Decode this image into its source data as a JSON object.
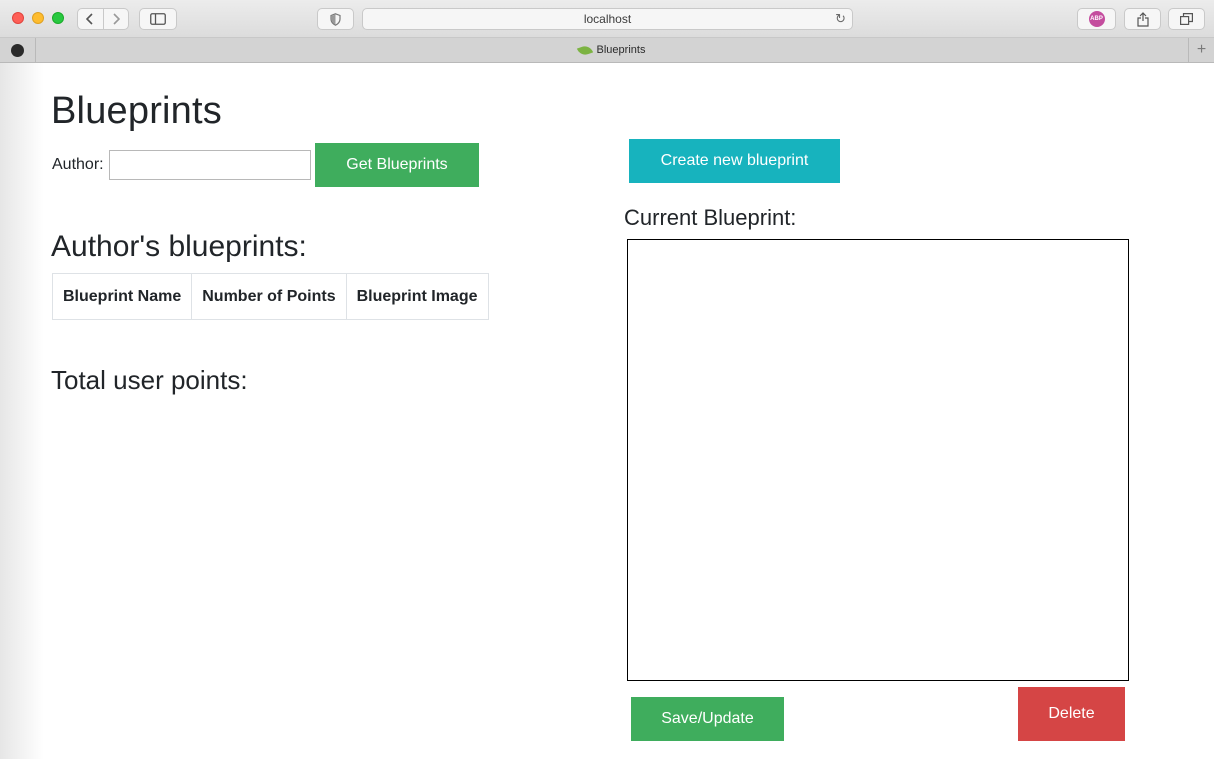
{
  "browser": {
    "url": "localhost",
    "tab_title": "Blueprints",
    "new_tab_symbol": "+",
    "abp_label": "ABP",
    "icons": [
      "back-icon",
      "forward-icon",
      "sidebar-icon",
      "shield-icon",
      "reload-icon",
      "share-icon",
      "tabs-overview-icon",
      "github-icon",
      "spring-leaf-icon"
    ]
  },
  "page": {
    "title": "Blueprints",
    "author_label": "Author:",
    "author_input_value": "",
    "get_button": "Get Blueprints",
    "create_button": "Create new blueprint",
    "authors_heading": "Author's blueprints:",
    "table": {
      "headers": [
        "Blueprint Name",
        "Number of Points",
        "Blueprint Image"
      ],
      "rows": []
    },
    "total_points_label": "Total user points:",
    "current_heading": "Current Blueprint:",
    "save_button": "Save/Update",
    "delete_button": "Delete"
  },
  "colors": {
    "success": "#3fad5d",
    "info": "#17b3be",
    "danger": "#d54545"
  }
}
